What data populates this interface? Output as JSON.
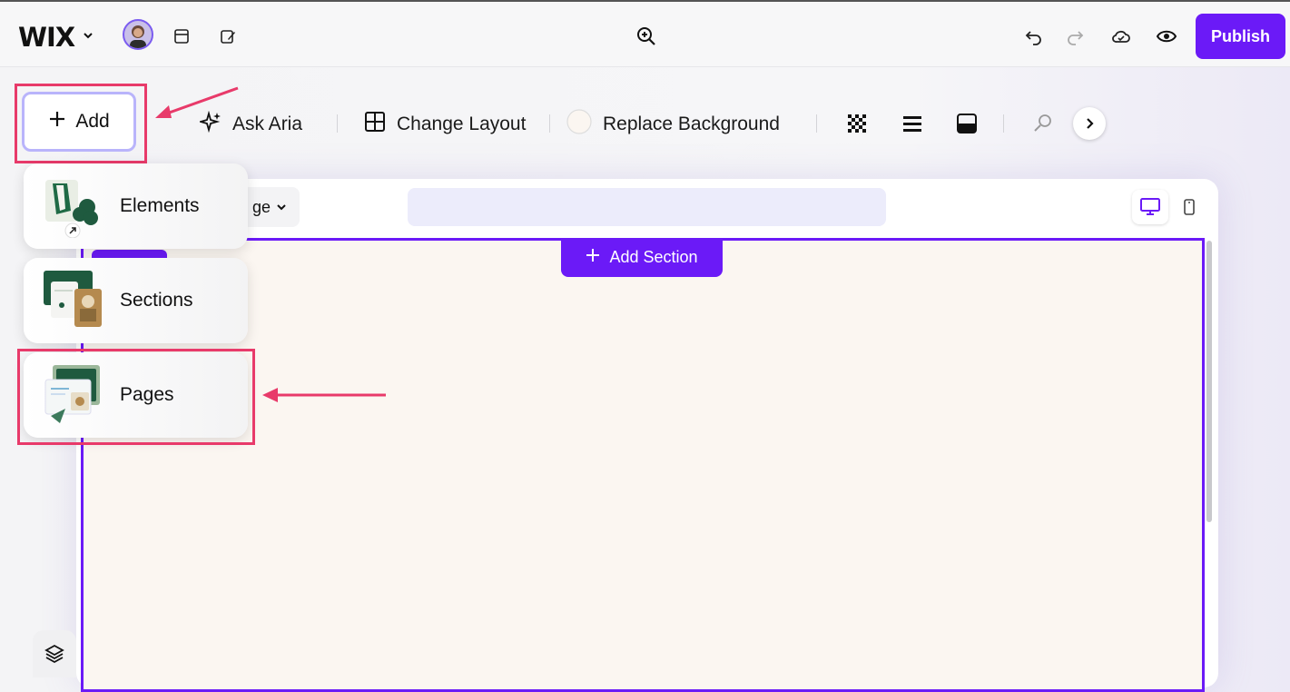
{
  "topbar": {
    "logo": "WIX",
    "publish_label": "Publish"
  },
  "toolbar": {
    "add_label": "Add",
    "ask_aria_label": "Ask Aria",
    "change_layout_label": "Change Layout",
    "replace_background_label": "Replace Background"
  },
  "canvas": {
    "page_select_label": "ge",
    "add_section_label": "Add Section"
  },
  "add_menu": {
    "items": [
      {
        "label": "Elements"
      },
      {
        "label": "Sections"
      },
      {
        "label": "Pages"
      }
    ]
  },
  "colors": {
    "accent": "#6b1af7",
    "highlight": "#e83a6a",
    "section_bg": "#fbf6f1"
  }
}
